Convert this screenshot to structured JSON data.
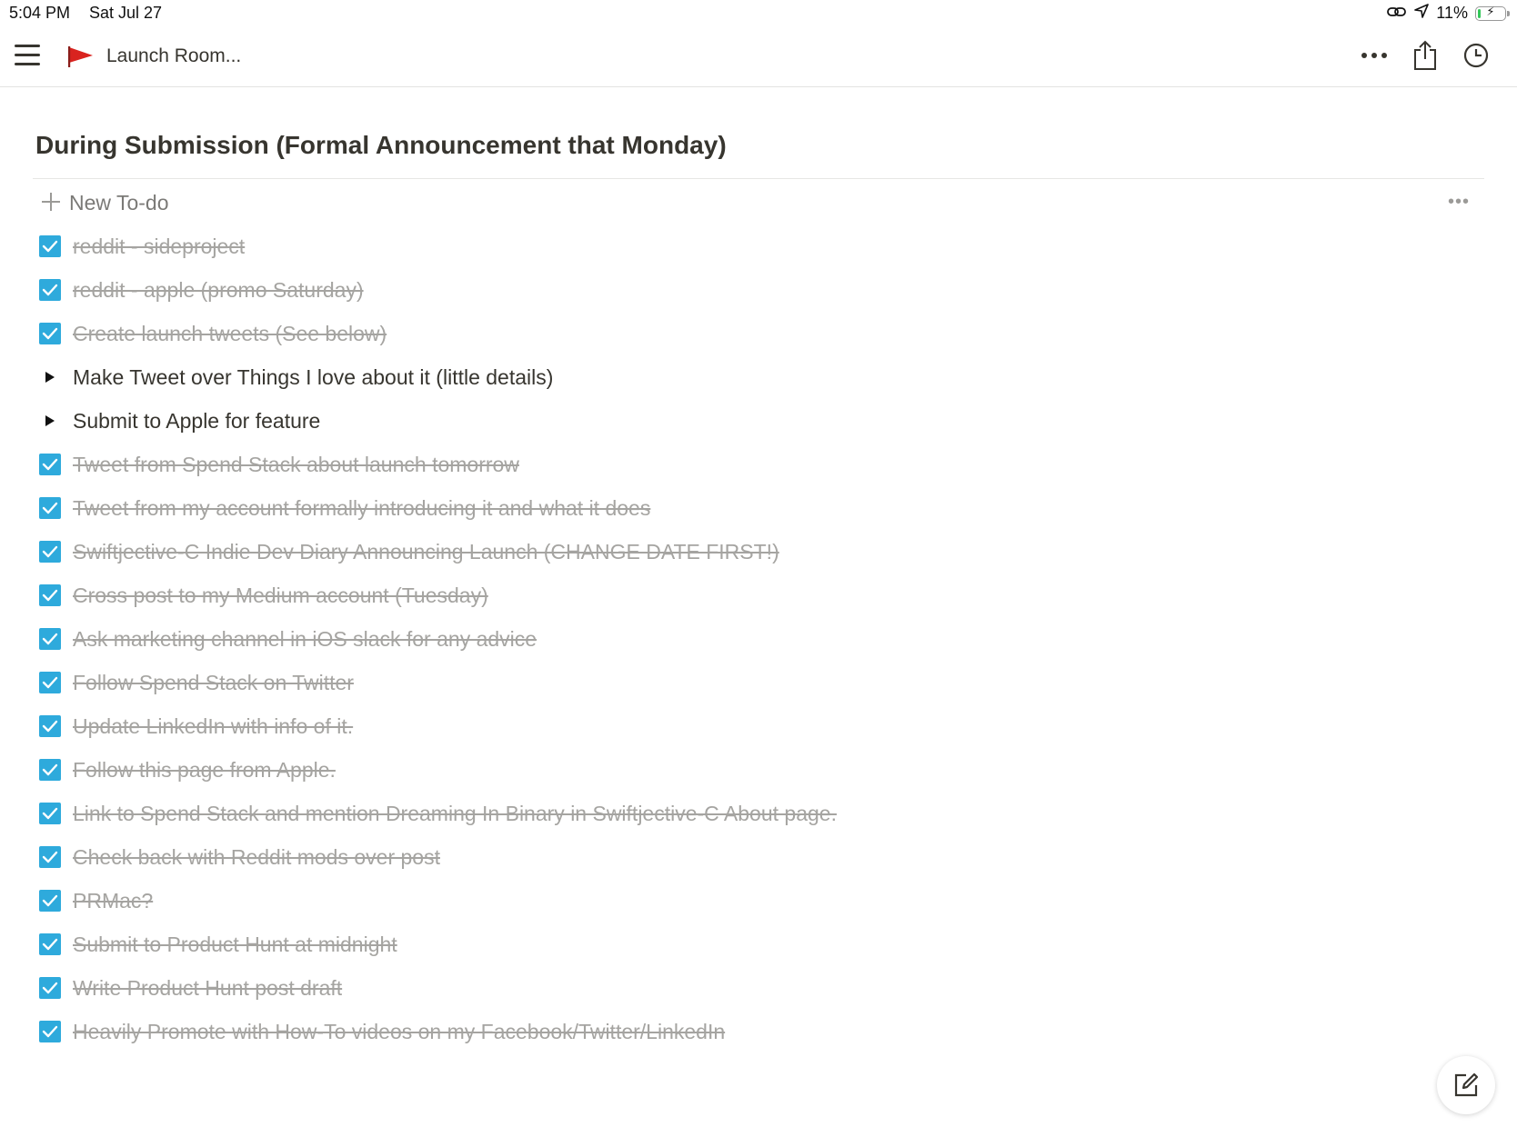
{
  "status_bar": {
    "time": "5:04 PM",
    "date": "Sat Jul 27",
    "battery_percent": "11%",
    "battery_level": 0.11,
    "icons": [
      "link-icon",
      "location-arrow-icon",
      "battery-charging-icon"
    ]
  },
  "topbar": {
    "page_title": "Launch Room...",
    "page_icon": "red-flag-icon",
    "actions": [
      "more-icon",
      "share-icon",
      "history-clock-icon"
    ]
  },
  "main": {
    "heading": "During Submission (Formal Announcement that Monday)",
    "new_todo_label": "New To-do",
    "todos": [
      {
        "text": "reddit - sideproject",
        "done": true
      },
      {
        "text": "reddit - apple (promo Saturday)",
        "done": true
      },
      {
        "text": "Create launch tweets (See below)",
        "done": true
      },
      {
        "text": "Make Tweet over Things I love about it (little details)",
        "done": false,
        "toggle": true
      },
      {
        "text": "Submit to Apple for feature",
        "done": false,
        "toggle": true
      },
      {
        "text": "Tweet from Spend Stack about launch tomorrow",
        "done": true
      },
      {
        "text": "Tweet from my account formally introducing it and what it does",
        "done": true
      },
      {
        "text": "Swiftjective-C Indie Dev Diary Announcing Launch (CHANGE DATE FIRST!)",
        "done": true
      },
      {
        "text": "Cross post to my Medium account (Tuesday)",
        "done": true
      },
      {
        "text": "Ask marketing channel in iOS slack for any advice",
        "done": true
      },
      {
        "text": "Follow Spend Stack on Twitter",
        "done": true
      },
      {
        "text": "Update LinkedIn with info of it.",
        "done": true
      },
      {
        "text": "Follow this page from Apple.",
        "done": true
      },
      {
        "text": "Link to Spend Stack and mention Dreaming In Binary in Swiftjective-C About page.",
        "done": true
      },
      {
        "text": "Check back with Reddit mods over post",
        "done": true
      },
      {
        "text": "PRMac?",
        "done": true
      },
      {
        "text": "Submit to Product Hunt at midnight",
        "done": true
      },
      {
        "text": "Write Product Hunt post draft",
        "done": true
      },
      {
        "text": "Heavily Promote with How-To videos on my Facebook/Twitter/LinkedIn",
        "done": true
      }
    ]
  },
  "colors": {
    "checkbox": "#2eaadc",
    "done_text": "#a5a4a1",
    "text": "#37352f",
    "flag": "#d9231f",
    "battery": "#34c759"
  }
}
